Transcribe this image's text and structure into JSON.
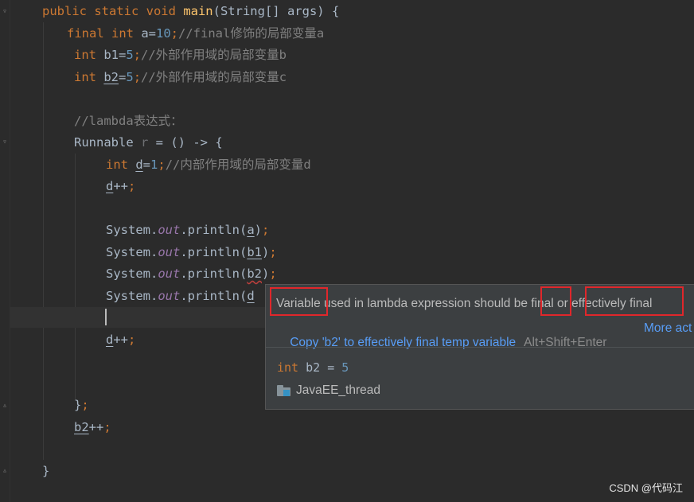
{
  "editor": {
    "lines": [
      {
        "id": "main",
        "tokens": [
          [
            "kw",
            "public static void "
          ],
          [
            "fn",
            "main"
          ],
          [
            "plain",
            "(String[] args) {"
          ]
        ]
      },
      {
        "id": "a",
        "tokens": [
          [
            "kw",
            "final int "
          ],
          [
            "plain",
            "a="
          ],
          [
            "num",
            "10"
          ],
          [
            "kw",
            ";"
          ],
          [
            "cmt",
            "//final修饰的局部变量a"
          ]
        ]
      },
      {
        "id": "b1",
        "tokens": [
          [
            "kw",
            "int "
          ],
          [
            "plain",
            "b1="
          ],
          [
            "num",
            "5"
          ],
          [
            "kw",
            ";"
          ],
          [
            "cmt",
            "//外部作用域的局部变量b"
          ]
        ]
      },
      {
        "id": "b2",
        "tokens": [
          [
            "kw",
            "int "
          ],
          [
            "ul",
            "b2"
          ],
          [
            "plain",
            "="
          ],
          [
            "num",
            "5"
          ],
          [
            "kw",
            ";"
          ],
          [
            "cmt",
            "//外部作用域的局部变量c"
          ]
        ]
      },
      {
        "id": "cmt-lambda",
        "tokens": [
          [
            "cmt",
            "//lambda表达式："
          ]
        ]
      },
      {
        "id": "runnable",
        "tokens": [
          [
            "plain",
            "Runnable "
          ],
          [
            "grey",
            "r"
          ],
          [
            "plain",
            " = () -> {"
          ]
        ]
      },
      {
        "id": "d",
        "tokens": [
          [
            "kw",
            "int "
          ],
          [
            "ul",
            "d"
          ],
          [
            "plain",
            "="
          ],
          [
            "num",
            "1"
          ],
          [
            "kw",
            ";"
          ],
          [
            "cmt",
            "//内部作用域的局部变量d"
          ]
        ]
      },
      {
        "id": "dpp1",
        "tokens": [
          [
            "ul",
            "d"
          ],
          [
            "plain",
            "++"
          ],
          [
            "kw",
            ";"
          ]
        ]
      },
      {
        "id": "print-a",
        "tokens": [
          [
            "plain",
            "System."
          ],
          [
            "fld",
            "out"
          ],
          [
            "plain",
            ".println("
          ],
          [
            "ul",
            "a"
          ],
          [
            "plain",
            ")"
          ],
          [
            "kw",
            ";"
          ]
        ]
      },
      {
        "id": "print-b1",
        "tokens": [
          [
            "plain",
            "System."
          ],
          [
            "fld",
            "out"
          ],
          [
            "plain",
            ".println("
          ],
          [
            "ul",
            "b1"
          ],
          [
            "plain",
            ")"
          ],
          [
            "kw",
            ";"
          ]
        ]
      },
      {
        "id": "print-b2",
        "tokens": [
          [
            "plain",
            "System."
          ],
          [
            "fld",
            "out"
          ],
          [
            "plain",
            ".println("
          ],
          [
            "wavyul",
            "b2"
          ],
          [
            "plain",
            ")"
          ],
          [
            "kw",
            ";"
          ]
        ]
      },
      {
        "id": "print-d",
        "tokens": [
          [
            "plain",
            "System."
          ],
          [
            "fld",
            "out"
          ],
          [
            "plain",
            ".println("
          ],
          [
            "ul",
            "d"
          ]
        ]
      },
      {
        "id": "dpp2",
        "tokens": [
          [
            "ul",
            "d"
          ],
          [
            "plain",
            "++"
          ],
          [
            "kw",
            ";"
          ]
        ]
      },
      {
        "id": "close-lambda",
        "tokens": [
          [
            "plain",
            "}"
          ],
          [
            "kw",
            ";"
          ]
        ]
      },
      {
        "id": "b2pp",
        "tokens": [
          [
            "ul",
            "b2"
          ],
          [
            "plain",
            "++"
          ],
          [
            "kw",
            ";"
          ]
        ]
      },
      {
        "id": "close-main",
        "tokens": [
          [
            "plain",
            "}"
          ]
        ]
      }
    ]
  },
  "popup": {
    "message": {
      "w1": "Variable",
      "w2": " used in lambda expression should be ",
      "w3": "final",
      "w4": " or ",
      "w5": "effectively final"
    },
    "fix_label": "Copy 'b2' to effectively final temp variable",
    "fix_shortcut": "Alt+Shift+Enter",
    "more_label": "More act",
    "declaration": {
      "keyword": "int",
      "rest": " b2 = ",
      "value": "5"
    },
    "module": "JavaEE_thread",
    "module_icon": "module-folder-icon"
  },
  "watermark": "CSDN @代码江",
  "colors": {
    "background": "#2b2b2b",
    "keyword": "#cc7832",
    "method": "#ffc66d",
    "number": "#6897bb",
    "comment": "#808080",
    "field": "#9876aa",
    "link": "#589df6",
    "highlight_box": "#e0272b"
  }
}
